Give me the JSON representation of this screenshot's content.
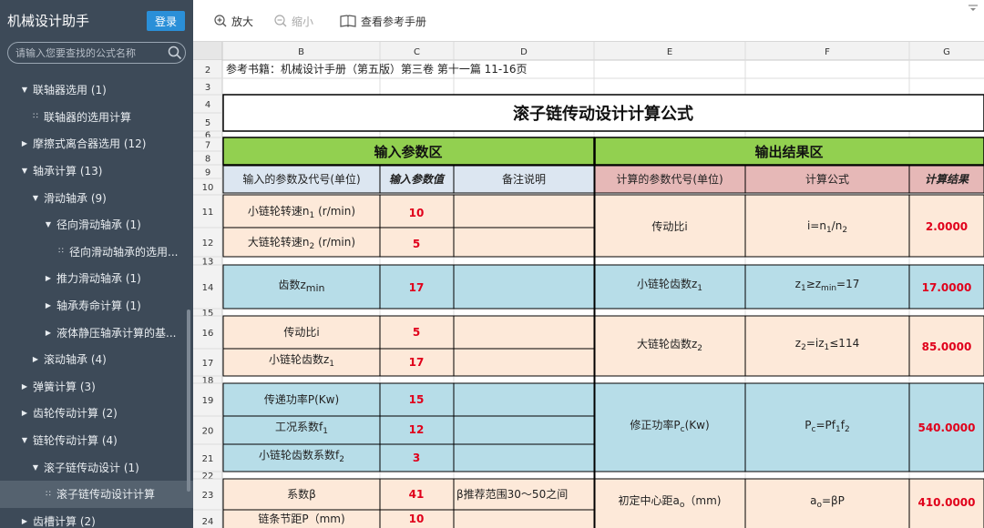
{
  "app": {
    "title": "机械设计助手",
    "login_label": "登录",
    "search_placeholder": "请输入您要查找的公式名称"
  },
  "tree": [
    {
      "label": "联轴器选用 (1)",
      "depth": 0,
      "marker": "down"
    },
    {
      "label": "联轴器的选用计算",
      "depth": 1,
      "marker": "dots"
    },
    {
      "label": "摩擦式离合器选用 (12)",
      "depth": 0,
      "marker": "right"
    },
    {
      "label": "轴承计算 (13)",
      "depth": 0,
      "marker": "down"
    },
    {
      "label": "滑动轴承 (9)",
      "depth": 1,
      "marker": "down"
    },
    {
      "label": "径向滑动轴承 (1)",
      "depth": 2,
      "marker": "down"
    },
    {
      "label": "径向滑动轴承的选用...",
      "depth": 3,
      "marker": "dots"
    },
    {
      "label": "推力滑动轴承 (1)",
      "depth": 2,
      "marker": "right"
    },
    {
      "label": "轴承寿命计算 (1)",
      "depth": 2,
      "marker": "right"
    },
    {
      "label": "液体静压轴承计算的基...",
      "depth": 2,
      "marker": "right"
    },
    {
      "label": "滚动轴承 (4)",
      "depth": 1,
      "marker": "right"
    },
    {
      "label": "弹簧计算 (3)",
      "depth": 0,
      "marker": "right"
    },
    {
      "label": "齿轮传动计算 (2)",
      "depth": 0,
      "marker": "right"
    },
    {
      "label": "链轮传动计算 (4)",
      "depth": 0,
      "marker": "down"
    },
    {
      "label": "滚子链传动设计 (1)",
      "depth": 1,
      "marker": "down"
    },
    {
      "label": "滚子链传动设计计算",
      "depth": 2,
      "marker": "dots",
      "active": true
    },
    {
      "label": "齿槽计算 (2)",
      "depth": 0,
      "marker": "right"
    }
  ],
  "toolbar": {
    "zoom_in": "放大",
    "zoom_out": "缩小",
    "manual": "查看参考手册"
  },
  "sheet": {
    "col_headers": [
      "B",
      "C",
      "D",
      "E",
      "F",
      "G"
    ],
    "row_numbers": [
      "2",
      "3",
      "4",
      "5",
      "6",
      "7",
      "8",
      "9",
      "10",
      "11",
      "12",
      "13",
      "14",
      "15",
      "16",
      "17",
      "18",
      "19",
      "20",
      "21",
      "22",
      "23",
      "24"
    ],
    "reference": "参考书籍：机械设计手册（第五版）第三卷 第十一篇 11-16页",
    "title": "滚子链传动设计计算公式",
    "input_section": "输入参数区",
    "output_section": "输出结果区",
    "hdr_input_param": "输入的参数及代号(单位)",
    "hdr_input_value": "输入参数值",
    "hdr_note": "备注说明",
    "hdr_output_param": "计算的参数代号(单位)",
    "hdr_formula": "计算公式",
    "hdr_result": "计算结果",
    "inputs": [
      {
        "label": "小链轮转速n₁ (r/min)",
        "value": "10"
      },
      {
        "label": "大链轮转速n₂ (r/min)",
        "value": "5"
      },
      {
        "label": "齿数z_min",
        "value": "17"
      },
      {
        "label": "传动比i",
        "value": "5"
      },
      {
        "label": "小链轮齿数z₁",
        "value": "17"
      },
      {
        "label": "传递功率P(Kw)",
        "value": "15"
      },
      {
        "label": "工况系数f₁",
        "value": "12"
      },
      {
        "label": "小链轮齿数系数f₂",
        "value": "3"
      },
      {
        "label": "系数β",
        "value": "41",
        "note": "β推荐范围30～50之间"
      },
      {
        "label": "链条节距P（mm)",
        "value": "10"
      }
    ],
    "outputs": [
      {
        "label": "传动比i",
        "formula": "i=n₁/n₂",
        "result": "2.0000"
      },
      {
        "label": "小链轮齿数z₁",
        "formula": "z₁≥z_min=17",
        "result": "17.0000"
      },
      {
        "label": "大链轮齿数z₂",
        "formula": "z₂=iz₁≤114",
        "result": "85.0000"
      },
      {
        "label": "修正功率P_c(Kw)",
        "formula": "P_c=Pf₁f₂",
        "result": "540.0000"
      },
      {
        "label": "初定中心距a_o（mm)",
        "formula": "a_o=βP",
        "result": "410.0000"
      }
    ],
    "colors": {
      "input_bg": "#fde9d9",
      "blue_bg": "#b7dde8",
      "green_bar": "#92d050",
      "header_blue": "#dce6f1",
      "header_red": "#e6b8b7",
      "result_red": "#e0001b"
    }
  }
}
